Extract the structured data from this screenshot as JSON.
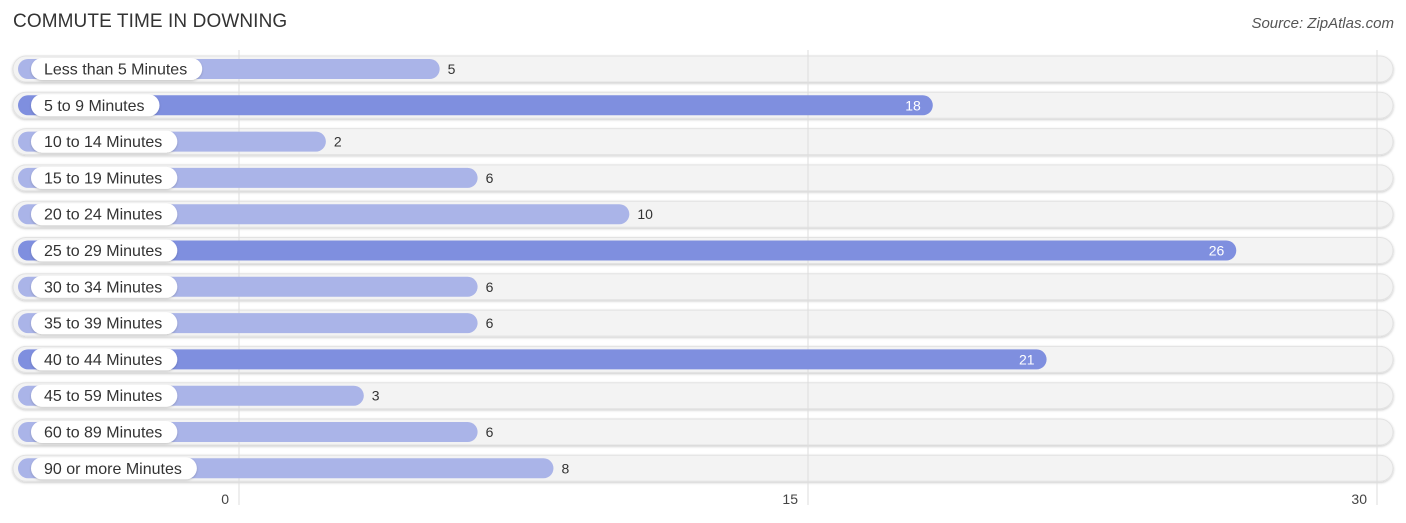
{
  "header": {
    "title": "COMMUTE TIME IN DOWNING",
    "source": "Source: ZipAtlas.com"
  },
  "colors": {
    "bar_light": "#aab4e8",
    "bar_dark": "#7f8fdf",
    "track": "#f3f3f3",
    "grid": "#dddddd"
  },
  "chart_data": {
    "type": "bar",
    "orientation": "horizontal",
    "title": "COMMUTE TIME IN DOWNING",
    "xlabel": "",
    "ylabel": "",
    "xlim": [
      0,
      30
    ],
    "x_ticks": [
      0,
      15,
      30
    ],
    "grid": true,
    "categories": [
      "Less than 5 Minutes",
      "5 to 9 Minutes",
      "10 to 14 Minutes",
      "15 to 19 Minutes",
      "20 to 24 Minutes",
      "25 to 29 Minutes",
      "30 to 34 Minutes",
      "35 to 39 Minutes",
      "40 to 44 Minutes",
      "45 to 59 Minutes",
      "60 to 89 Minutes",
      "90 or more Minutes"
    ],
    "values": [
      5,
      18,
      2,
      6,
      10,
      26,
      6,
      6,
      21,
      3,
      6,
      8
    ]
  }
}
